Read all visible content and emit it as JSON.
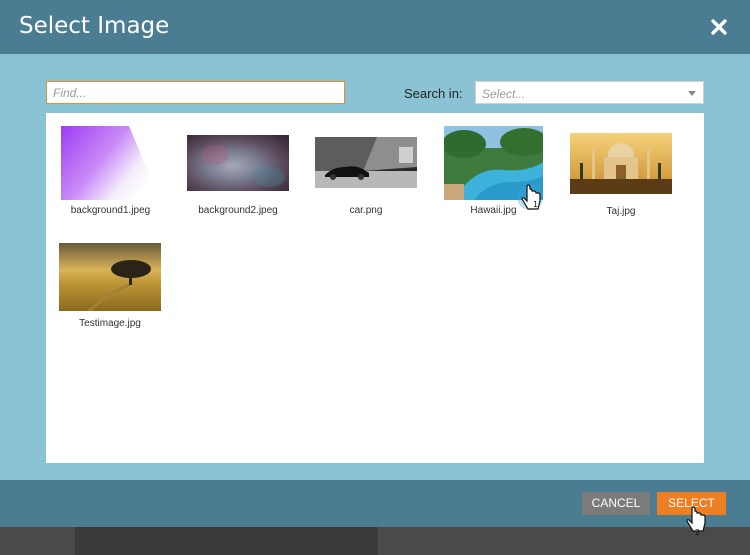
{
  "dialog": {
    "title": "Select Image",
    "close_icon": "close-icon"
  },
  "search": {
    "find_placeholder": "Find...",
    "find_value": "",
    "search_in_label": "Search in:",
    "select_placeholder": "Select..."
  },
  "images": [
    {
      "name": "background1.jpeg"
    },
    {
      "name": "background2.jpeg"
    },
    {
      "name": "car.png"
    },
    {
      "name": "Hawaii.jpg"
    },
    {
      "name": "Taj.jpg"
    },
    {
      "name": "Testimage.jpg"
    }
  ],
  "footer": {
    "cancel_label": "CANCEL",
    "select_label": "SELECT"
  },
  "annotations": {
    "step1": "1",
    "step2": "2"
  },
  "colors": {
    "header": "#4a7d91",
    "body": "#8ac3d4",
    "accent": "#ee7e22",
    "cancel": "#7b7b7b"
  }
}
